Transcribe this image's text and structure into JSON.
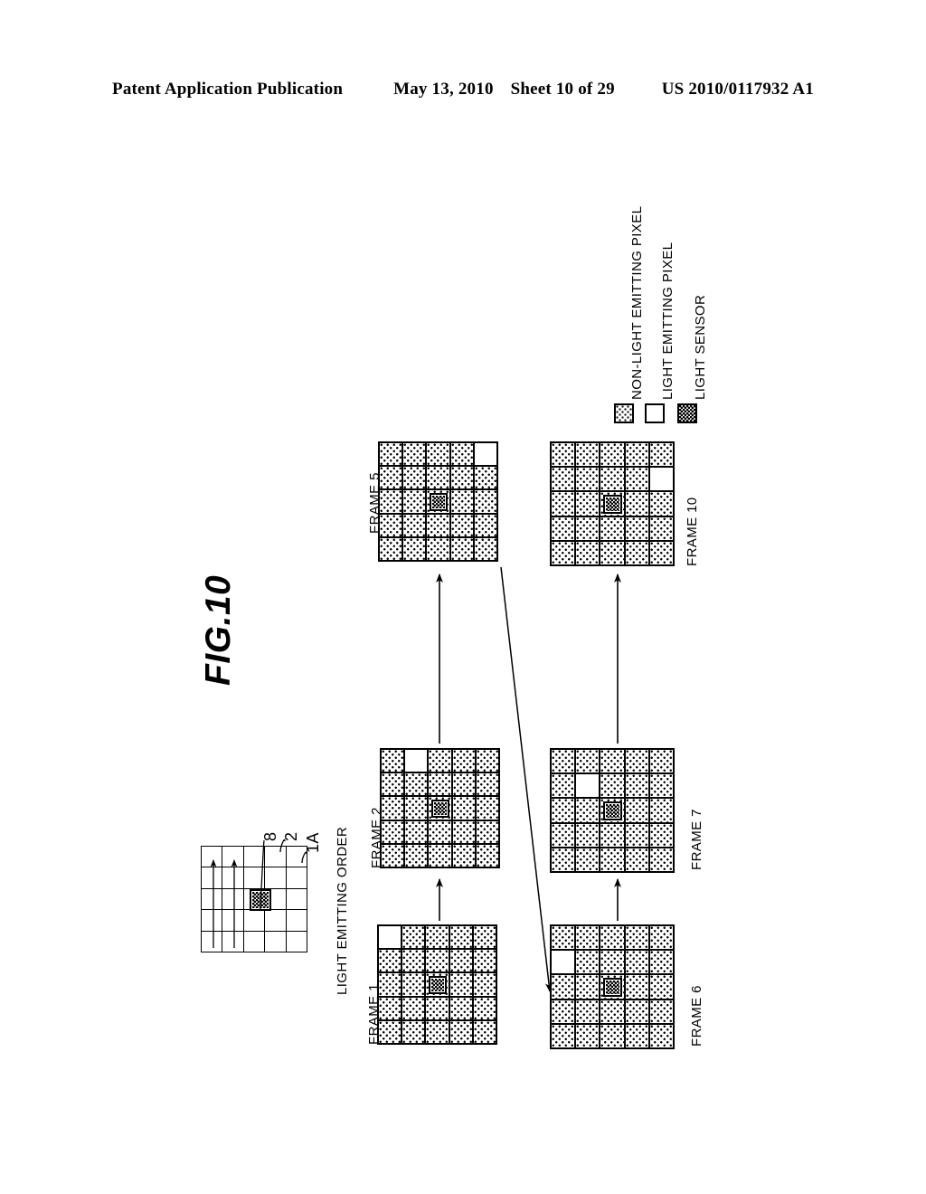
{
  "header": {
    "publication": "Patent Application Publication",
    "date": "May 13, 2010",
    "sheet": "Sheet 10 of 29",
    "doc_number": "US 2010/0117932 A1"
  },
  "figure": {
    "title": "FIG.10",
    "light_emitting_order_label": "LIGHT EMITTING ORDER",
    "reference_labels": {
      "pixel_8": "8",
      "pixel_2": "2",
      "panel_1a": "1A"
    }
  },
  "legend": {
    "items": [
      {
        "label": "NON-LIGHT EMITTING PIXEL",
        "swatch": "light-stipple"
      },
      {
        "label": "LIGHT EMITTING PIXEL",
        "swatch": "white"
      },
      {
        "label": "LIGHT SENSOR",
        "swatch": "dark-stipple"
      }
    ]
  },
  "frames": [
    {
      "label": "FRAME 1",
      "grid_rows": 5,
      "grid_cols": 5,
      "emitting_cell": {
        "row": 5,
        "col": 1
      },
      "sensor_cell": {
        "row": 3,
        "col": 3
      }
    },
    {
      "label": "FRAME 2",
      "grid_rows": 5,
      "grid_cols": 5,
      "emitting_cell": {
        "row": 4,
        "col": 1
      },
      "sensor_cell": {
        "row": 3,
        "col": 3
      }
    },
    {
      "label": "FRAME 5",
      "grid_rows": 5,
      "grid_cols": 5,
      "emitting_cell": {
        "row": 1,
        "col": 1
      },
      "sensor_cell": {
        "row": 3,
        "col": 3
      }
    },
    {
      "label": "FRAME 6",
      "grid_rows": 5,
      "grid_cols": 5,
      "emitting_cell": {
        "row": 5,
        "col": 2
      },
      "sensor_cell": {
        "row": 3,
        "col": 3
      }
    },
    {
      "label": "FRAME 7",
      "grid_rows": 5,
      "grid_cols": 5,
      "emitting_cell": {
        "row": 4,
        "col": 2
      },
      "sensor_cell": {
        "row": 3,
        "col": 3
      }
    },
    {
      "label": "FRAME 10",
      "grid_rows": 5,
      "grid_cols": 5,
      "emitting_cell": {
        "row": 1,
        "col": 2
      },
      "sensor_cell": {
        "row": 3,
        "col": 3
      }
    }
  ],
  "colors": {
    "ink": "#000000",
    "paper": "#ffffff"
  }
}
